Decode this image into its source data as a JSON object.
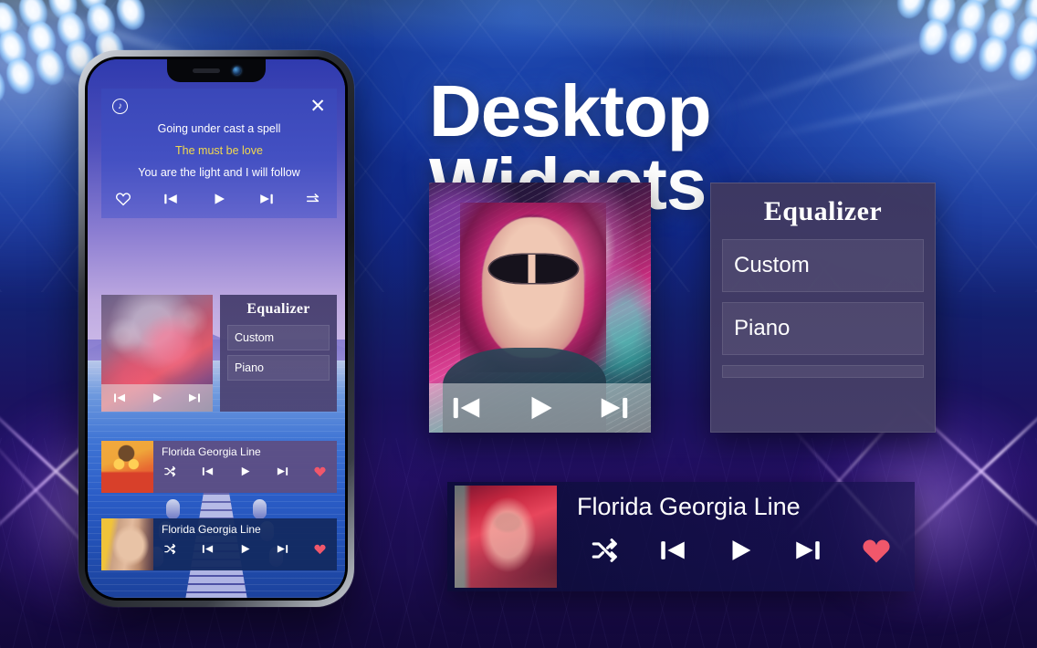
{
  "headline": "Desktop Widgets",
  "colors": {
    "accent_yellow": "#f2d94e",
    "heart_red": "#f0576b",
    "widget_purple": "#5e4e82",
    "widget_navy": "#132a61",
    "eq_panel": "#46406c"
  },
  "phone": {
    "lyrics_widget": {
      "app_icon": "music-note-icon",
      "close_icon": "close-icon",
      "lines": [
        {
          "text": "Going under cast a spell",
          "highlight": false
        },
        {
          "text": "The must be love",
          "highlight": true
        },
        {
          "text": "You are the light and I will follow",
          "highlight": false
        }
      ],
      "controls": [
        {
          "name": "favorite",
          "icon": "heart-outline-icon"
        },
        {
          "name": "previous",
          "icon": "skip-previous-icon"
        },
        {
          "name": "play",
          "icon": "play-icon"
        },
        {
          "name": "next",
          "icon": "skip-next-icon"
        },
        {
          "name": "queue",
          "icon": "playlist-arrows-icon"
        }
      ]
    },
    "art_widget": {
      "controls": [
        {
          "name": "previous",
          "icon": "skip-previous-icon"
        },
        {
          "name": "play",
          "icon": "play-icon"
        },
        {
          "name": "next",
          "icon": "skip-next-icon"
        }
      ]
    },
    "equalizer_widget": {
      "title": "Equalizer",
      "presets": [
        "Custom",
        "Piano"
      ]
    },
    "song_widgets": [
      {
        "title": "Florida Georgia Line",
        "theme": "purple",
        "controls": [
          {
            "name": "shuffle",
            "icon": "shuffle-icon"
          },
          {
            "name": "previous",
            "icon": "skip-previous-icon"
          },
          {
            "name": "play",
            "icon": "play-icon"
          },
          {
            "name": "next",
            "icon": "skip-next-icon"
          },
          {
            "name": "favorite",
            "icon": "heart-filled-icon"
          }
        ]
      },
      {
        "title": "Florida Georgia Line",
        "theme": "navy",
        "controls": [
          {
            "name": "shuffle",
            "icon": "shuffle-icon"
          },
          {
            "name": "previous",
            "icon": "skip-previous-icon"
          },
          {
            "name": "play",
            "icon": "play-icon"
          },
          {
            "name": "next",
            "icon": "skip-next-icon"
          },
          {
            "name": "favorite",
            "icon": "heart-filled-icon"
          }
        ]
      }
    ]
  },
  "showcase": {
    "photo_widget": {
      "controls": [
        {
          "name": "previous",
          "icon": "skip-previous-icon"
        },
        {
          "name": "play",
          "icon": "play-icon"
        },
        {
          "name": "next",
          "icon": "skip-next-icon"
        }
      ]
    },
    "equalizer_widget": {
      "title": "Equalizer",
      "presets": [
        "Custom",
        "Piano"
      ]
    },
    "now_playing_widget": {
      "title": "Florida Georgia Line",
      "controls": [
        {
          "name": "shuffle",
          "icon": "shuffle-icon"
        },
        {
          "name": "previous",
          "icon": "skip-previous-icon"
        },
        {
          "name": "play",
          "icon": "play-icon"
        },
        {
          "name": "next",
          "icon": "skip-next-icon"
        },
        {
          "name": "favorite",
          "icon": "heart-filled-icon"
        }
      ]
    }
  }
}
